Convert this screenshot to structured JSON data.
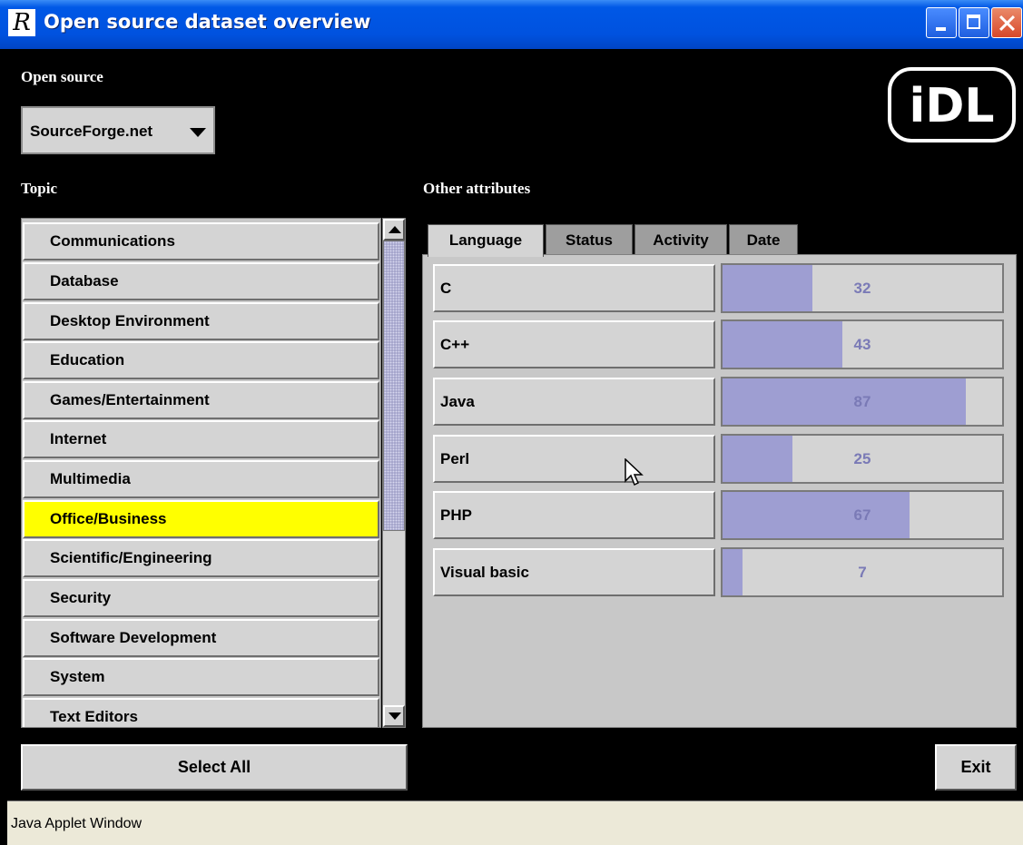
{
  "window": {
    "title": "Open source dataset overview",
    "app_icon_glyph": "R",
    "titlebar_color": "#0052df"
  },
  "open_source": {
    "label": "Open source",
    "selected": "SourceForge.net"
  },
  "logo": {
    "text": "iDL"
  },
  "topic": {
    "label": "Topic",
    "selected_color": "#ffff00",
    "items": [
      {
        "label": "Communications",
        "selected": false
      },
      {
        "label": "Database",
        "selected": false
      },
      {
        "label": "Desktop Environment",
        "selected": false
      },
      {
        "label": "Education",
        "selected": false
      },
      {
        "label": "Games/Entertainment",
        "selected": false
      },
      {
        "label": "Internet",
        "selected": false
      },
      {
        "label": "Multimedia",
        "selected": false
      },
      {
        "label": "Office/Business",
        "selected": true
      },
      {
        "label": "Scientific/Engineering",
        "selected": false
      },
      {
        "label": "Security",
        "selected": false
      },
      {
        "label": "Software Development",
        "selected": false
      },
      {
        "label": "System",
        "selected": false
      },
      {
        "label": "Text Editors",
        "selected": false
      }
    ]
  },
  "other_attributes": {
    "label": "Other attributes",
    "tabs": [
      {
        "label": "Language",
        "active": true
      },
      {
        "label": "Status",
        "active": false
      },
      {
        "label": "Activity",
        "active": false
      },
      {
        "label": "Date",
        "active": false
      }
    ],
    "bar_color": "#9e9ed2",
    "max_value": 100,
    "languages": [
      {
        "label": "C",
        "value": 32
      },
      {
        "label": "C++",
        "value": 43
      },
      {
        "label": "Java",
        "value": 87
      },
      {
        "label": "Perl",
        "value": 25
      },
      {
        "label": "PHP",
        "value": 67
      },
      {
        "label": "Visual basic",
        "value": 7
      }
    ]
  },
  "buttons": {
    "select_all": "Select All",
    "exit": "Exit"
  },
  "status_bar": {
    "text": "Java Applet Window"
  }
}
